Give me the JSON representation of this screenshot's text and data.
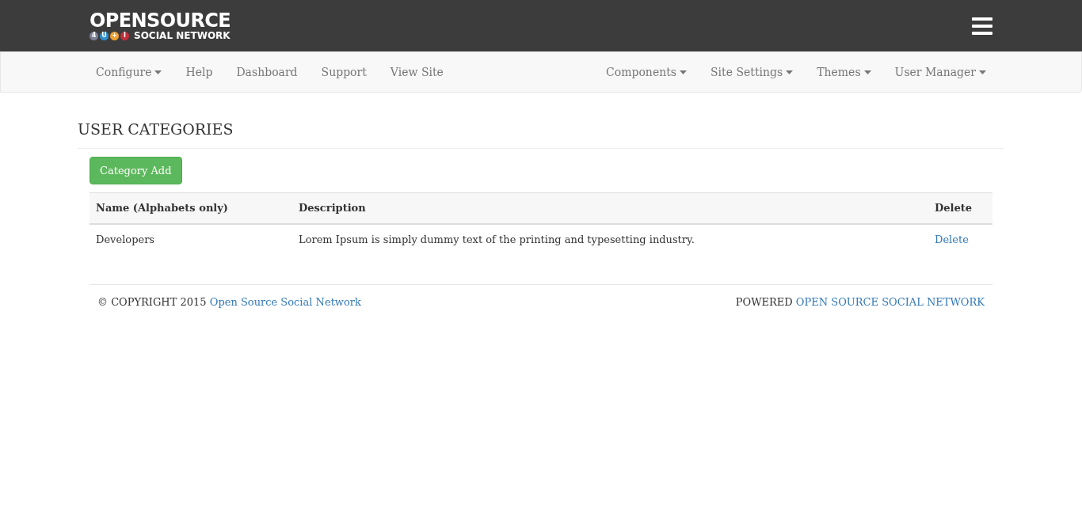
{
  "logo": {
    "title": "OPENSOURCE",
    "badges": [
      {
        "text": "4",
        "color": "#7a7f95"
      },
      {
        "text": "U",
        "color": "#2f8fd0"
      },
      {
        "text": "+",
        "color": "#f0a030"
      },
      {
        "text": "I",
        "color": "#c0303a"
      }
    ],
    "subtitle": "SOCIAL NETWORK"
  },
  "nav_left": [
    {
      "label": "Configure",
      "dropdown": true
    },
    {
      "label": "Help",
      "dropdown": false
    },
    {
      "label": "Dashboard",
      "dropdown": false
    },
    {
      "label": "Support",
      "dropdown": false
    },
    {
      "label": "View Site",
      "dropdown": false
    }
  ],
  "nav_right": [
    {
      "label": "Components",
      "dropdown": true
    },
    {
      "label": "Site Settings",
      "dropdown": true
    },
    {
      "label": "Themes",
      "dropdown": true
    },
    {
      "label": "User Manager",
      "dropdown": true
    }
  ],
  "page_title": "USER CATEGORIES",
  "add_button": "Category Add",
  "table": {
    "columns": [
      "Name (Alphabets only)",
      "Description",
      "Delete"
    ],
    "rows": [
      {
        "name": "Developers",
        "description": "Lorem Ipsum is simply dummy text of the printing and typesetting industry.",
        "action": "Delete"
      }
    ]
  },
  "footer": {
    "copyright": "© COPYRIGHT 2015",
    "copyright_link": "Open Source Social Network",
    "powered": "POWERED",
    "powered_link": "OPEN SOURCE SOCIAL NETWORK"
  }
}
